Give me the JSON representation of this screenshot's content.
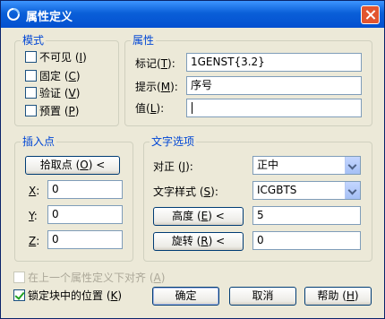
{
  "window": {
    "title": "属性定义",
    "icon": "app-logo-icon",
    "close_icon": "close-icon"
  },
  "mode": {
    "legend": "模式",
    "options": [
      {
        "label": "不可见",
        "key": "I",
        "checked": false
      },
      {
        "label": "固定",
        "key": "C",
        "checked": false
      },
      {
        "label": "验证",
        "key": "V",
        "checked": false
      },
      {
        "label": "预置",
        "key": "P",
        "checked": false
      }
    ]
  },
  "attribute": {
    "legend": "属性",
    "tag_label": "标记",
    "tag_key": "T",
    "tag_value": "1GENST{3.2}",
    "prompt_label": "提示",
    "prompt_key": "M",
    "prompt_value": "序号",
    "value_label": "值",
    "value_key": "L",
    "value_value": ""
  },
  "insertion": {
    "legend": "插入点",
    "pick_label": "拾取点",
    "pick_key": "O",
    "pick_suffix": " <",
    "x_key": "X",
    "x_value": "0",
    "y_key": "Y",
    "y_value": "0",
    "z_key": "Z",
    "z_value": "0"
  },
  "text_options": {
    "legend": "文字选项",
    "justify_label": "对正",
    "justify_key": "J",
    "justify_value": "正中",
    "style_label": "文字样式",
    "style_key": "S",
    "style_value": "ICGBTS",
    "height_label": "高度",
    "height_key": "E",
    "height_suffix": " <",
    "height_value": "5",
    "rotation_label": "旋转",
    "rotation_key": "R",
    "rotation_suffix": " <",
    "rotation_value": "0"
  },
  "align_below": {
    "label": "在上一个属性定义下对齐",
    "key": "A",
    "checked": false,
    "enabled": false
  },
  "lock_position": {
    "label": "锁定块中的位置",
    "key": "K",
    "checked": true
  },
  "buttons": {
    "ok": "确定",
    "cancel": "取消",
    "help_label": "帮助",
    "help_key": "H"
  }
}
